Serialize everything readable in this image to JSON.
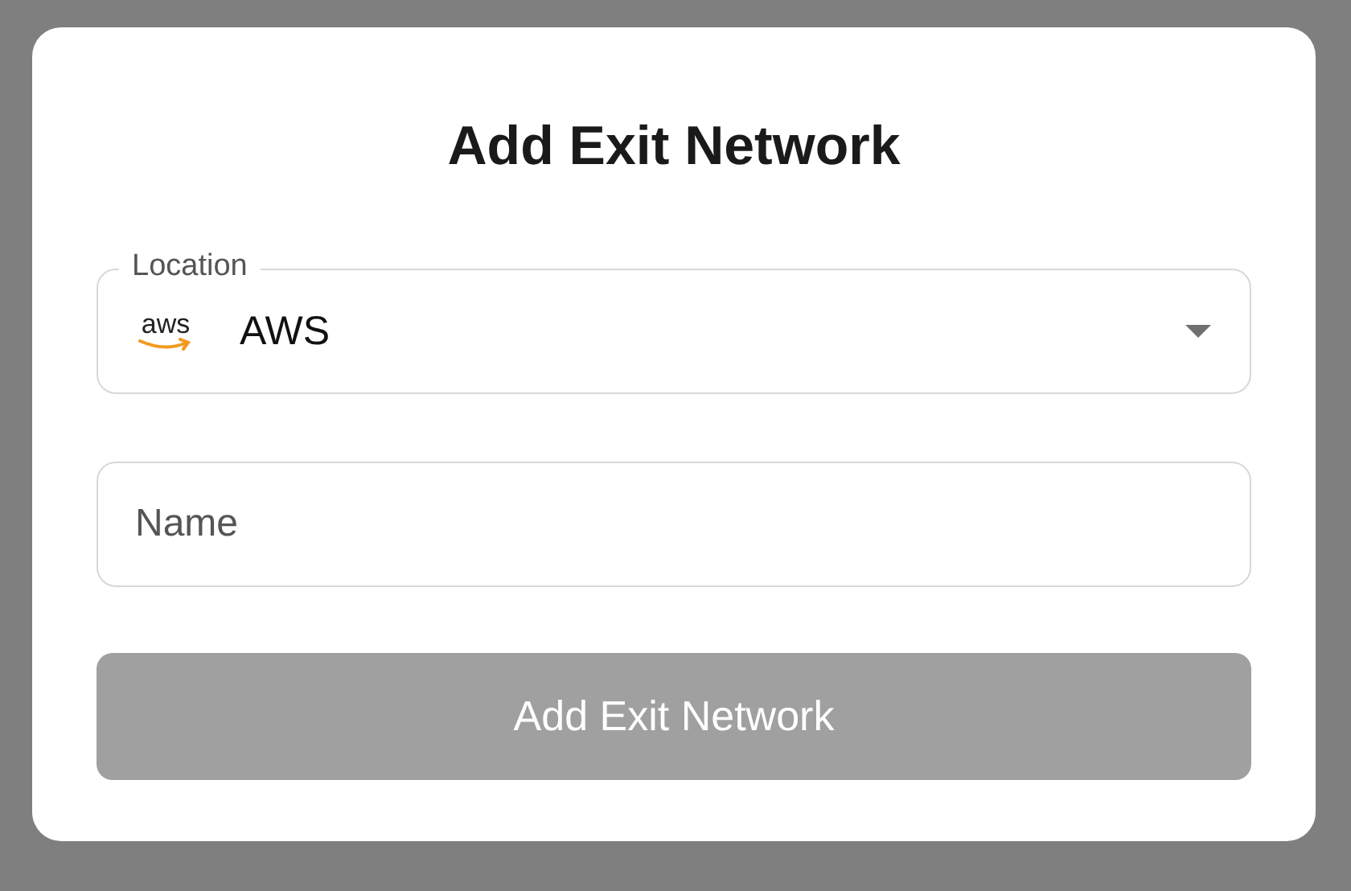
{
  "dialog": {
    "title": "Add Exit Network"
  },
  "location": {
    "label": "Location",
    "logo_text": "aws",
    "value": "AWS"
  },
  "name": {
    "placeholder": "Name"
  },
  "submit": {
    "label": "Add Exit Network",
    "disabled": true
  }
}
